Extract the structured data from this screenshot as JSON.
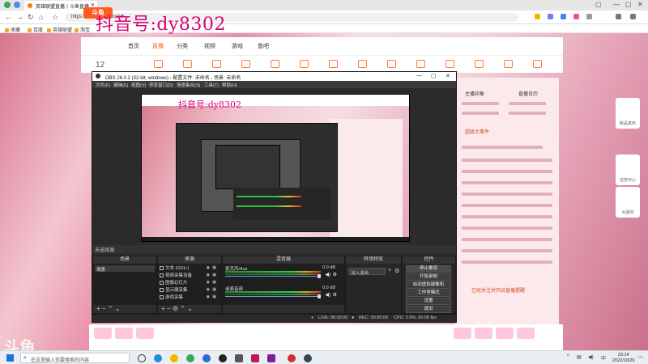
{
  "browser": {
    "tab_title": "英雄联盟直播丨斗鱼直播",
    "url": "https://www.douyu.com/",
    "bookmarks": [
      "收藏",
      "百度",
      "英雄联盟",
      "淘宝"
    ]
  },
  "watermark": "抖音号:dy8302",
  "site": {
    "logo": "斗鱼",
    "nav": [
      "首页",
      "直播",
      "分类",
      "视频",
      "游戏",
      "鱼吧"
    ],
    "counter": "12",
    "right_panel": {
      "tab1": "主播印象",
      "tab2": "直播日历",
      "notice": "超级大事件",
      "footer_text": "已经关注并开启直播提醒"
    },
    "watermark_brand": "斗鱼",
    "side_cards": [
      "新品发布",
      "任务中心",
      "大回归"
    ]
  },
  "obs": {
    "title": "OBS 26.0.2 (32-bit, windows) - 配置文件: 未命名 - 场景: 未命名",
    "menu": [
      "文件(F)",
      "编辑(E)",
      "视图(V)",
      "停靠窗口(D)",
      "场景集合(S)",
      "工具(T)",
      "帮助(H)"
    ],
    "status_strip_label": "未选择源",
    "docks": {
      "scenes_title": "场景",
      "sources_title": "来源",
      "mixer_title": "混音器",
      "transitions_title": "转场特效",
      "controls_title": "控件"
    },
    "scenes": [
      "场景"
    ],
    "sources": [
      "文本 (GDI+)",
      "视频采集设备",
      "图像幻灯片",
      "显示器采集",
      "游戏采集"
    ],
    "mixer": [
      {
        "name": "麦克风/Aux",
        "db": "0.0 dB"
      },
      {
        "name": "桌面音频",
        "db": "0.0 dB"
      }
    ],
    "transition": "淡入淡出",
    "controls": [
      "停止推流",
      "开始录制",
      "启动虚拟摄像机",
      "工作室模式",
      "设置",
      "退出"
    ],
    "statusbar": {
      "live": "LIVE: 00:00:00",
      "rec": "REC: 00:00:00",
      "cpu": "CPU: 3.9%, 60.00 fps"
    }
  },
  "taskbar": {
    "search_placeholder": "在这里输入你要搜索的内容",
    "time": "23:14",
    "date": "2022/10/26"
  }
}
